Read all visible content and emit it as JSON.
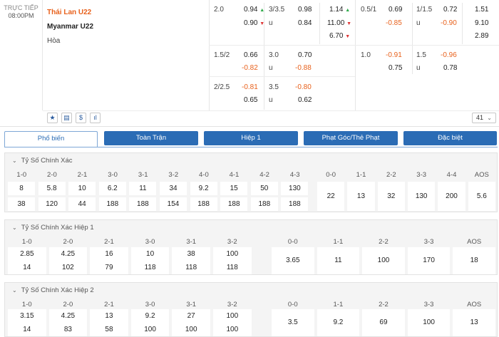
{
  "match": {
    "live_label": "TRỰC TIẾP",
    "time": "08:00PM",
    "home": "Thái Lan U22",
    "away": "Myanmar U22",
    "draw": "Hòa"
  },
  "odds": {
    "row1": {
      "hcp_line": "2.0",
      "hcp_home": "0.94",
      "hcp_away": "0.90",
      "ou_line": "3/3.5",
      "ou_over": "0.98",
      "ou_under_lbl": "u",
      "ou_under": "0.84",
      "x12_home": "1.14",
      "x12_away": "11.00",
      "x12_draw": "6.70",
      "h1_hcp_line": "0.5/1",
      "h1_hcp_home": "0.69",
      "h1_hcp_away": "-0.85",
      "h1_ou_line": "1/1.5",
      "h1_ou_over": "0.72",
      "h1_ou_under_lbl": "u",
      "h1_ou_under": "-0.90",
      "h1_x12_home": "1.51",
      "h1_x12_away": "9.10",
      "h1_x12_draw": "2.89"
    },
    "row2": {
      "hcp_line": "1.5/2",
      "hcp_home": "0.66",
      "hcp_away": "-0.82",
      "ou_line": "3.0",
      "ou_over": "0.70",
      "ou_under_lbl": "u",
      "ou_under": "-0.88",
      "h1_hcp_line": "1.0",
      "h1_hcp_home": "-0.91",
      "h1_hcp_away": "0.75",
      "h1_ou_line": "1.5",
      "h1_ou_over": "-0.96",
      "h1_ou_under_lbl": "u",
      "h1_ou_under": "0.78"
    },
    "row3": {
      "hcp_line": "2/2.5",
      "hcp_home": "-0.81",
      "hcp_away": "0.65",
      "ou_line": "3.5",
      "ou_over": "-0.80",
      "ou_under_lbl": "u",
      "ou_under": "0.62"
    }
  },
  "tools": {
    "star": "★",
    "stats": "▤",
    "money": "$",
    "chart": "ıl",
    "more_count": "41",
    "more_chev": "⌄"
  },
  "tabs": [
    "Phổ biến",
    "Toàn Trận",
    "Hiệp 1",
    "Phạt Góc/Thẻ Phạt",
    "Đặc biệt"
  ],
  "sections": [
    {
      "title": "Tỷ Số Chính Xác",
      "home_labels": [
        "1-0",
        "2-0",
        "2-1",
        "3-0",
        "3-1",
        "3-2",
        "4-0",
        "4-1",
        "4-2",
        "4-3"
      ],
      "home_top": [
        "8",
        "5.8",
        "10",
        "6.2",
        "11",
        "34",
        "9.2",
        "15",
        "50",
        "130"
      ],
      "home_bottom": [
        "38",
        "120",
        "44",
        "188",
        "188",
        "154",
        "188",
        "188",
        "188",
        "188"
      ],
      "draw_labels": [
        "0-0",
        "1-1",
        "2-2",
        "3-3",
        "4-4",
        "AOS"
      ],
      "draw_values": [
        "22",
        "13",
        "32",
        "130",
        "200",
        "5.6"
      ]
    },
    {
      "title": "Tỷ Số Chính Xác Hiệp 1",
      "home_labels": [
        "1-0",
        "2-0",
        "2-1",
        "3-0",
        "3-1",
        "3-2"
      ],
      "home_top": [
        "2.85",
        "4.25",
        "16",
        "10",
        "38",
        "100"
      ],
      "home_bottom": [
        "14",
        "102",
        "79",
        "118",
        "118",
        "118"
      ],
      "draw_labels": [
        "0-0",
        "1-1",
        "2-2",
        "3-3",
        "AOS"
      ],
      "draw_values": [
        "3.65",
        "11",
        "100",
        "170",
        "18"
      ]
    },
    {
      "title": "Tỷ Số Chính Xác Hiệp 2",
      "home_labels": [
        "1-0",
        "2-0",
        "2-1",
        "3-0",
        "3-1",
        "3-2"
      ],
      "home_top": [
        "3.15",
        "4.25",
        "13",
        "9.2",
        "27",
        "100"
      ],
      "home_bottom": [
        "14",
        "83",
        "58",
        "100",
        "100",
        "100"
      ],
      "draw_labels": [
        "0-0",
        "1-1",
        "2-2",
        "3-3",
        "AOS"
      ],
      "draw_values": [
        "3.5",
        "9.2",
        "69",
        "100",
        "13"
      ]
    }
  ]
}
